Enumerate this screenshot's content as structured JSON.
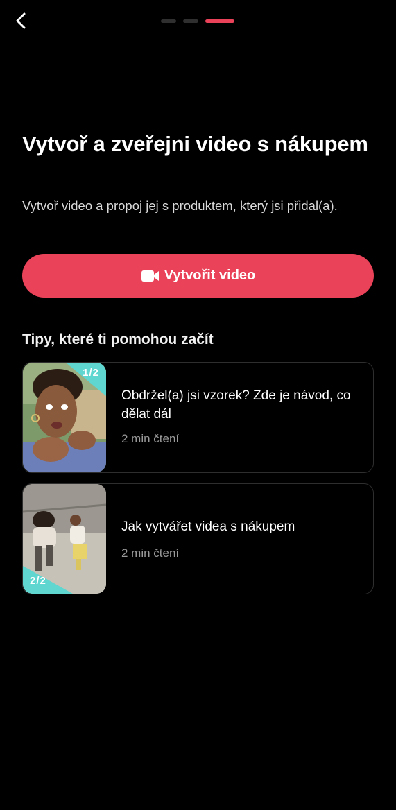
{
  "header": {
    "back_icon": "chevron-left-icon",
    "progress": {
      "total_steps": 3,
      "current_step": 3
    }
  },
  "intro": {
    "headline": "Vytvoř a zveřejni video s nákupem",
    "subtitle": "Vytvoř video a propoj jej s produktem, který jsi přidal(a)."
  },
  "create_button": {
    "icon": "video-camera-icon",
    "label": "Vytvořit video"
  },
  "tips": {
    "title": "Tipy, které ti pomohou začít",
    "items": [
      {
        "title_line1": "Obdržel(a) jsi vzorek? Zde je návod, co",
        "title_line2": "dělat dál",
        "meta": "2 min čtení",
        "badge": "1/2"
      },
      {
        "title": "Jak vytvářet videa s nákupem",
        "meta": "2 min čtení",
        "badge": "2/2"
      }
    ]
  },
  "colors": {
    "background": "#000000",
    "accent": "#ea4359",
    "badge": "#5fd6d0",
    "muted_text": "#9a9a9a"
  }
}
